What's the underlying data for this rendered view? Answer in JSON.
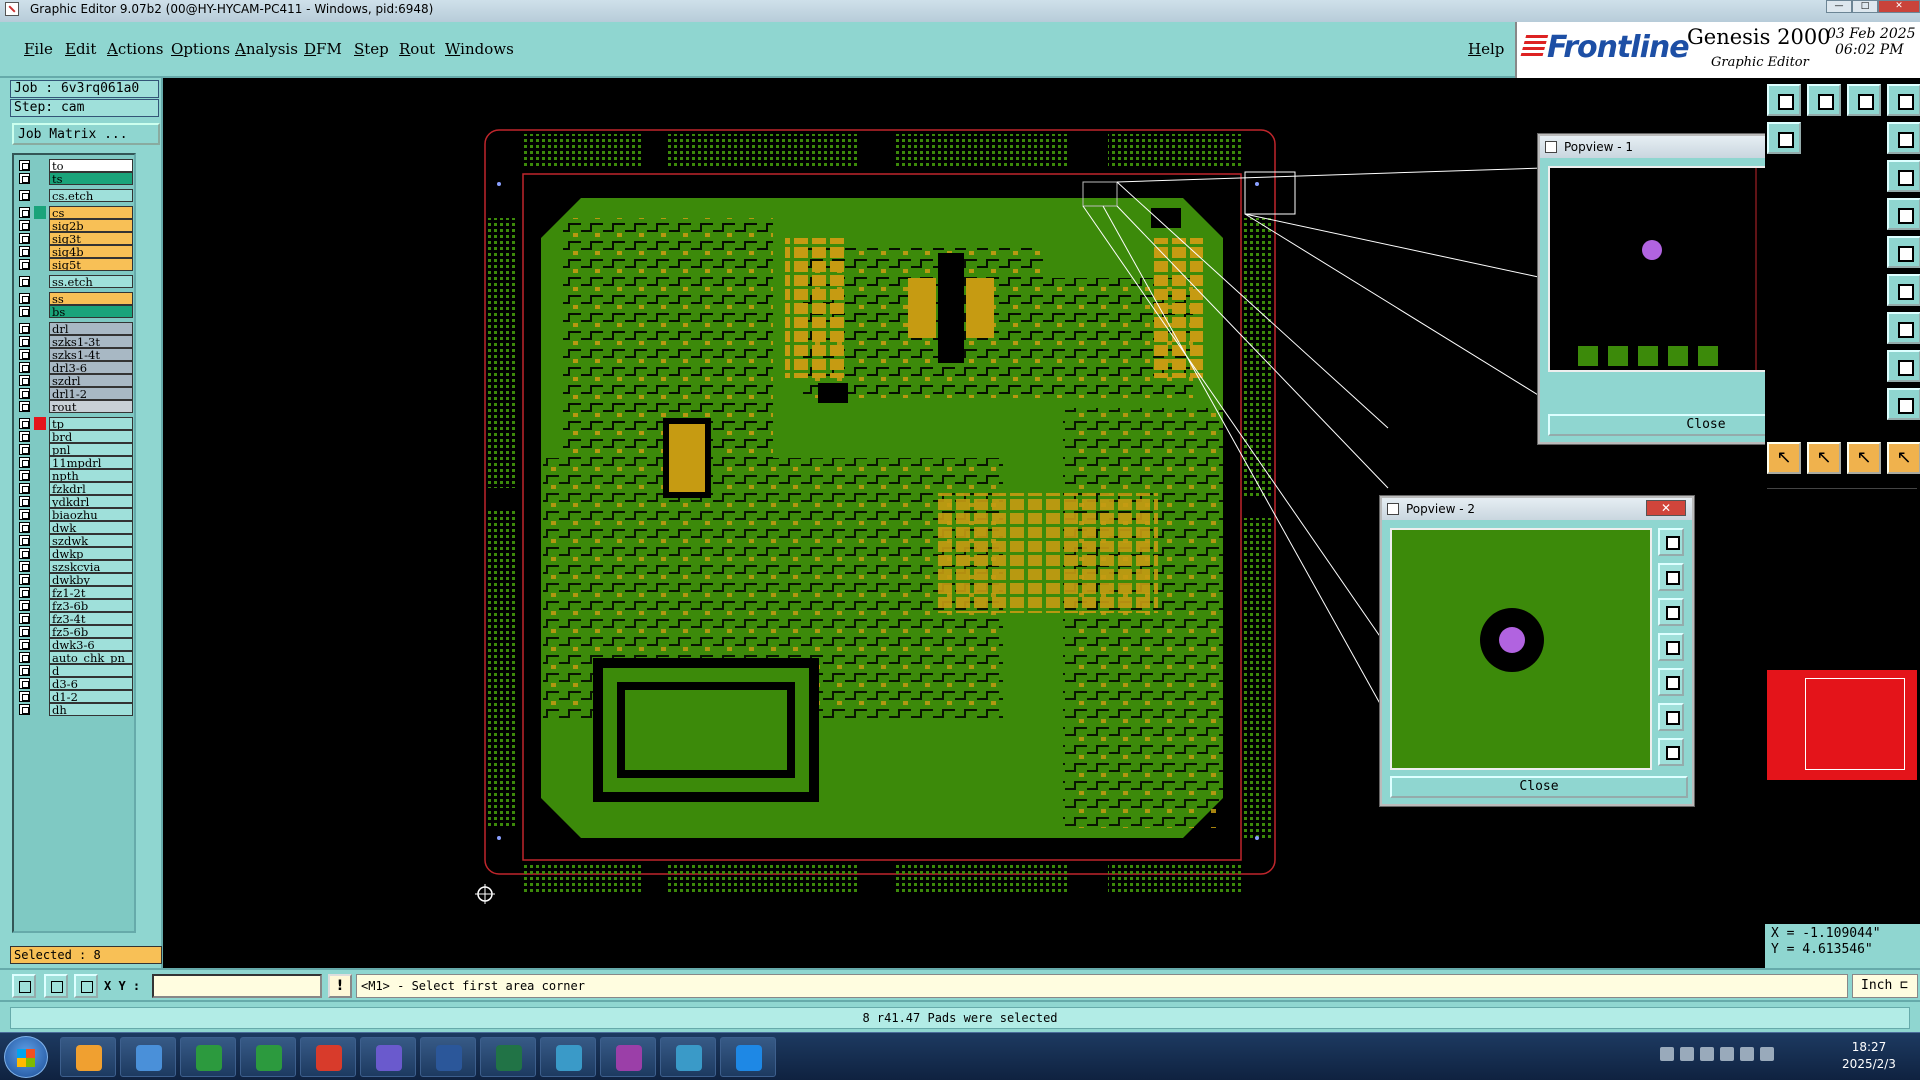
{
  "window": {
    "title": "Graphic Editor 9.07b2 (00@HY-HYCAM-PC411 - Windows, pid:6948)",
    "controls": [
      "—",
      "□",
      "✕"
    ]
  },
  "menu": {
    "items": [
      "File",
      "Edit",
      "Actions",
      "Options",
      "Analysis",
      "DFM",
      "Step",
      "Rout",
      "Windows"
    ],
    "help": "Help"
  },
  "brand": {
    "logo": "Frontline",
    "product": "Genesis 2000",
    "subtitle": "Graphic Editor",
    "date": "03 Feb 2025",
    "time": "06:02 PM"
  },
  "job": {
    "job_line": "Job : 6v3rq061a0",
    "step_line": "Step: cam",
    "matrix_button": "Job Matrix ..."
  },
  "layers": [
    {
      "name": "to",
      "bg": "#ffffff"
    },
    {
      "name": "ts",
      "bg": "#1aa37a"
    },
    {
      "name": "cs.etch",
      "bg": "#9fe0da"
    },
    {
      "name": "cs",
      "bg": "#f8c056",
      "active": true
    },
    {
      "name": "sig2b",
      "bg": "#f8c056"
    },
    {
      "name": "sig3t",
      "bg": "#f8c056"
    },
    {
      "name": "sig4b",
      "bg": "#f8c056"
    },
    {
      "name": "sig5t",
      "bg": "#f8c056"
    },
    {
      "name": "ss.etch",
      "bg": "#9fe0da"
    },
    {
      "name": "ss",
      "bg": "#f8c056"
    },
    {
      "name": "bs",
      "bg": "#1aa37a"
    },
    {
      "name": "drl",
      "bg": "#a8b8c4"
    },
    {
      "name": "szks1-3t",
      "bg": "#a8b8c4"
    },
    {
      "name": "szks1-4t",
      "bg": "#a8b8c4"
    },
    {
      "name": "drl3-6",
      "bg": "#a8b8c4"
    },
    {
      "name": "szdrl",
      "bg": "#a8b8c4"
    },
    {
      "name": "drl1-2",
      "bg": "#a8b8c4"
    },
    {
      "name": "rout",
      "bg": "#c8d0d6"
    },
    {
      "name": "tp",
      "bg": "#9fe0da",
      "marked": true
    },
    {
      "name": "brd",
      "bg": "#9fe0da"
    },
    {
      "name": "pnl",
      "bg": "#9fe0da"
    },
    {
      "name": "11mpdrl",
      "bg": "#9fe0da"
    },
    {
      "name": "npth",
      "bg": "#9fe0da"
    },
    {
      "name": "fzkdrl",
      "bg": "#9fe0da"
    },
    {
      "name": "ydkdrl",
      "bg": "#9fe0da"
    },
    {
      "name": "biaozhu",
      "bg": "#9fe0da"
    },
    {
      "name": "dwk",
      "bg": "#9fe0da"
    },
    {
      "name": "szdwk",
      "bg": "#9fe0da"
    },
    {
      "name": "dwkp",
      "bg": "#9fe0da"
    },
    {
      "name": "szskcvia",
      "bg": "#9fe0da"
    },
    {
      "name": "dwkby",
      "bg": "#9fe0da"
    },
    {
      "name": "fz1-2t",
      "bg": "#9fe0da"
    },
    {
      "name": "fz3-6b",
      "bg": "#9fe0da"
    },
    {
      "name": "fz3-4t",
      "bg": "#9fe0da"
    },
    {
      "name": "fz5-6b",
      "bg": "#9fe0da"
    },
    {
      "name": "dwk3-6",
      "bg": "#9fe0da"
    },
    {
      "name": "auto_chk_pn",
      "bg": "#9fe0da"
    },
    {
      "name": "d",
      "bg": "#9fe0da"
    },
    {
      "name": "d3-6",
      "bg": "#9fe0da"
    },
    {
      "name": "d1-2",
      "bg": "#9fe0da"
    },
    {
      "name": "dh",
      "bg": "#9fe0da"
    }
  ],
  "selected_count": "Selected : 8",
  "popviews": [
    {
      "title": "Popview - 1",
      "close": "Close"
    },
    {
      "title": "Popview - 2",
      "close": "Close"
    }
  ],
  "coords": {
    "x": "X = -1.109044\"",
    "y": "Y = 4.613546\""
  },
  "command": {
    "xy_label": "X Y :",
    "xy_value": "",
    "bang": "!",
    "prompt": "<M1> - Select first area corner",
    "units": "Inch ⊏"
  },
  "status_message": "8 r41.47 Pads were selected",
  "clock": {
    "time": "18:27",
    "date": "2025/2/3"
  },
  "colors": {
    "board": "#3c8a0a",
    "copper": "#c69b12",
    "outline": "#c0262c",
    "pad": "#b163e0",
    "panel": "#8fd6d0"
  },
  "taskbar_apps": [
    "shell-icon",
    "notepad-icon",
    "genesis-p-icon",
    "genesis-p2-icon",
    "acrobat-icon",
    "save-icon",
    "word-icon",
    "excel-icon",
    "eye-icon",
    "editor-x-icon",
    "eye2-icon",
    "plane-icon"
  ]
}
